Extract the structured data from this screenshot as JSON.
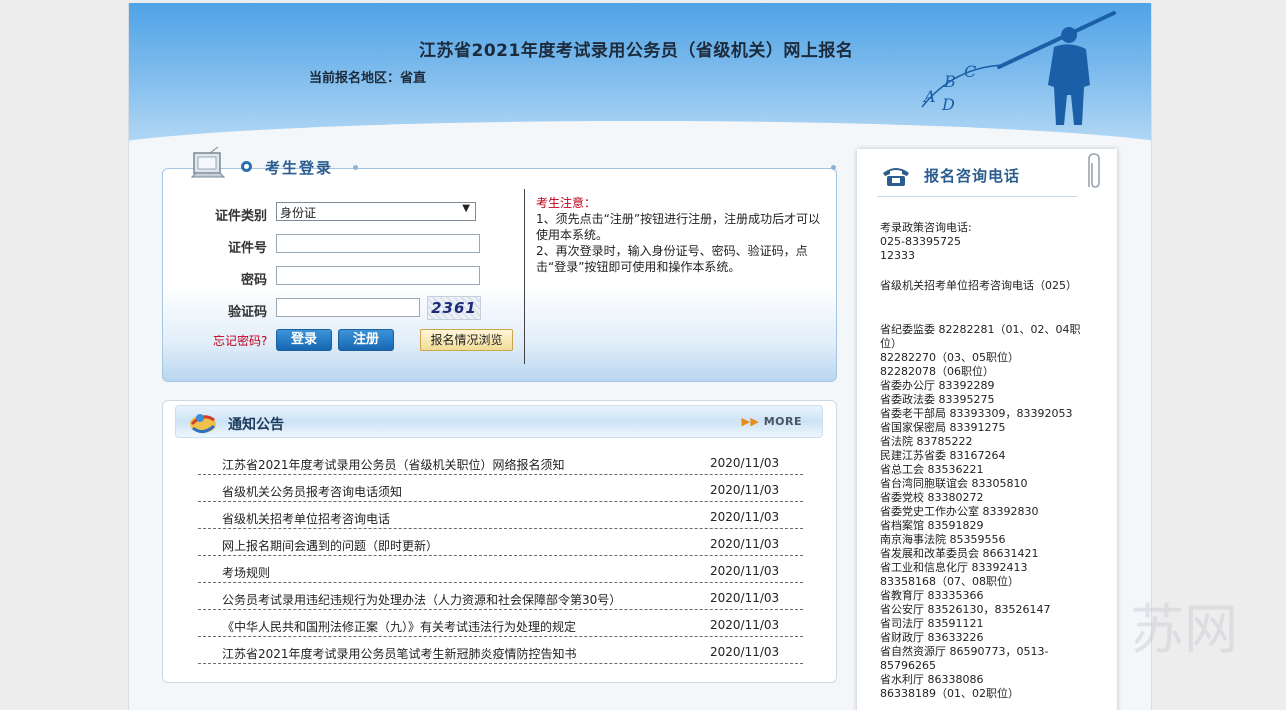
{
  "header": {
    "title": "江苏省2021年度考试录用公务员（省级机关）网上报名",
    "region": "当前报名地区：省直"
  },
  "login": {
    "title": "考生登录",
    "id_type_label": "证件类别",
    "id_type_value": "身份证",
    "id_no_label": "证件号",
    "password_label": "密码",
    "captcha_label": "验证码",
    "captcha_text": "2361",
    "forgot": "忘记密码?",
    "login_button": "登录",
    "register_button": "注册",
    "browse_button": "报名情况浏览",
    "notice_head": "考生注意：",
    "notice_1": "1、须先点击“注册”按钮进行注册，注册成功后才可以使用本系统。",
    "notice_2": "2、再次登录时，输入身份证号、密码、验证码，点击“登录”按钮即可使用和操作本系统。"
  },
  "announcements": {
    "title": "通知公告",
    "more": "MORE",
    "items": [
      {
        "title": "江苏省2021年度考试录用公务员（省级机关职位）网络报名须知",
        "date": "2020/11/03"
      },
      {
        "title": "省级机关公务员报考咨询电话须知",
        "date": "2020/11/03"
      },
      {
        "title": "省级机关招考单位招考咨询电话",
        "date": "2020/11/03"
      },
      {
        "title": "网上报名期间会遇到的问题（即时更新）",
        "date": "2020/11/03"
      },
      {
        "title": "考场规则",
        "date": "2020/11/03"
      },
      {
        "title": "公务员考试录用违纪违规行为处理办法（人力资源和社会保障部令第30号）",
        "date": "2020/11/03"
      },
      {
        "title": "《中华人民共和国刑法修正案（九）》有关考试违法行为处理的规定",
        "date": "2020/11/03"
      },
      {
        "title": "江苏省2021年度考试录用公务员笔试考生新冠肺炎疫情防控告知书",
        "date": "2020/11/03"
      }
    ]
  },
  "phone": {
    "title": "报名咨询电话",
    "policy_label": "考录政策咨询电话:",
    "policy_1": "025-83395725",
    "policy_2": "12333",
    "units_label": "省级机关招考单位招考咨询电话（025）",
    "lines": [
      "省纪委监委 82282281（01、02、04职位）",
      "82282270（03、05职位）",
      "82282078（06职位）",
      "省委办公厅 83392289",
      "省委政法委 83395275",
      "省委老干部局 83393309，83392053",
      "省国家保密局 83391275",
      "省法院 83785222",
      "民建江苏省委 83167264",
      "省总工会 83536221",
      "省台湾同胞联谊会 83305810",
      "省委党校 83380272",
      "省委党史工作办公室 83392830",
      "省档案馆 83591829",
      "南京海事法院 85359556",
      "省发展和改革委员会 86631421",
      "省工业和信息化厅 83392413",
      "83358168（07、08职位）",
      "省教育厅 83335366",
      "省公安厅 83526130，83526147",
      "省司法厅 83591121",
      "省财政厅 83633226",
      "省自然资源厅 86590773，0513-85796265",
      "省水利厅 86338086",
      "86338189（01、02职位）"
    ]
  },
  "watermark": "苏网",
  "colors": {
    "header_top": "#4fa3e6",
    "accent_blue": "#1667b2",
    "title_blue": "#2c5d8f",
    "alert_red": "#c0001c"
  }
}
